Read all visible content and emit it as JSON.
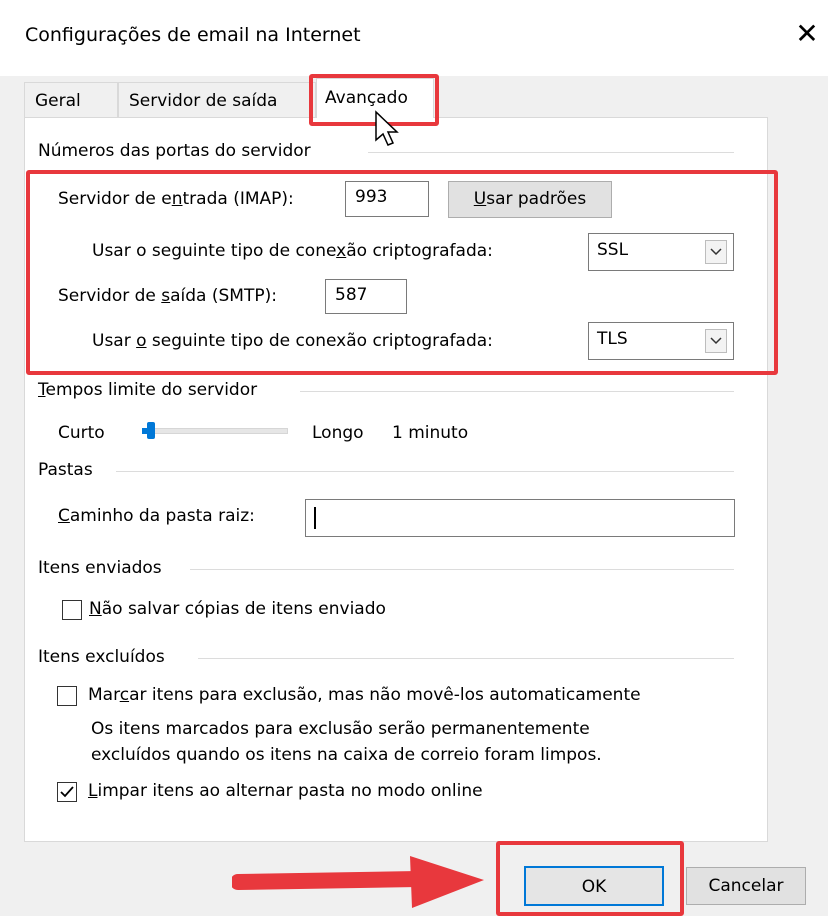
{
  "window": {
    "title": "Configurações de email na Internet",
    "close_glyph": "✕"
  },
  "tabs": [
    {
      "label": "Geral"
    },
    {
      "label": "Servidor de saída"
    },
    {
      "label": "Avançado"
    }
  ],
  "ports": {
    "group_label": "Números das portas do servidor",
    "incoming_label": "Servidor de entrada (IMAP):",
    "incoming_value": "993",
    "defaults_button": "Usar padrões",
    "incoming_enc_label": "Usar o seguinte tipo de conexão criptografada:",
    "incoming_enc_value": "SSL",
    "outgoing_label": "Servidor de saída (SMTP):",
    "outgoing_value": "587",
    "outgoing_enc_label": "Usar o seguinte tipo de conexão criptografada:",
    "outgoing_enc_value": "TLS"
  },
  "timeouts": {
    "group_label": "Tempos limite do servidor",
    "short_label": "Curto",
    "long_label": "Longo",
    "value_text": "1 minuto",
    "slider_fraction": 0.06
  },
  "folders": {
    "group_label": "Pastas",
    "root_path_label": "Caminho da pasta raiz:",
    "root_path_value": ""
  },
  "sent": {
    "group_label": "Itens enviados",
    "dont_save_label": "Não salvar cópias de itens enviado",
    "dont_save_checked": false
  },
  "deleted": {
    "group_label": "Itens excluídos",
    "mark_label": "Marcar itens para exclusão, mas não movê-los automaticamente",
    "mark_checked": false,
    "note_line1": "Os itens marcados para exclusão serão permanentemente",
    "note_line2": "excluídos quando os itens na caixa de correio foram limpos.",
    "purge_label": "Limpar itens ao alternar pasta no modo online",
    "purge_checked": true
  },
  "footer": {
    "ok_label": "OK",
    "cancel_label": "Cancelar"
  },
  "colors": {
    "highlight": "#e8383d",
    "accent": "#0078d7"
  },
  "icons": [
    "close-icon",
    "chevron-down-icon",
    "checkmark-icon",
    "mouse-cursor-icon",
    "arrow-right-icon"
  ]
}
